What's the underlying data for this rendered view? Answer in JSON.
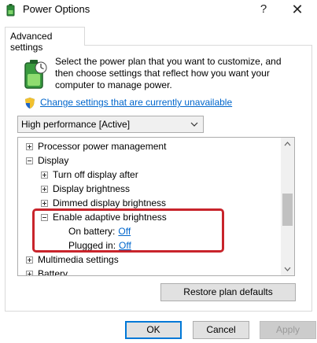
{
  "window": {
    "title": "Power Options",
    "help_glyph": "?",
    "close_glyph": "✕"
  },
  "tab": {
    "label": "Advanced settings"
  },
  "description": "Select the power plan that you want to customize, and then choose settings that reflect how you want your computer to manage power.",
  "change_link": "Change settings that are currently unavailable",
  "plan_select": {
    "value": "High performance [Active]"
  },
  "tree": {
    "rows": [
      {
        "label": "Processor power management"
      },
      {
        "label": "Display"
      },
      {
        "label": "Turn off display after"
      },
      {
        "label": "Display brightness"
      },
      {
        "label": "Dimmed display brightness"
      },
      {
        "label": "Enable adaptive brightness"
      },
      {
        "label": "On battery:",
        "value": "Off"
      },
      {
        "label": "Plugged in:",
        "value": "Off"
      },
      {
        "label": "Multimedia settings"
      },
      {
        "label": "Battery"
      }
    ]
  },
  "buttons": {
    "restore": "Restore plan defaults",
    "ok": "OK",
    "cancel": "Cancel",
    "apply": "Apply"
  },
  "colors": {
    "link": "#0066cc",
    "highlight": "#c8242b",
    "ok_border": "#0078d7"
  },
  "icons": [
    "power-options-icon",
    "battery-icon",
    "uac-shield-icon",
    "chevron-down-icon",
    "expand-icon",
    "collapse-icon"
  ]
}
